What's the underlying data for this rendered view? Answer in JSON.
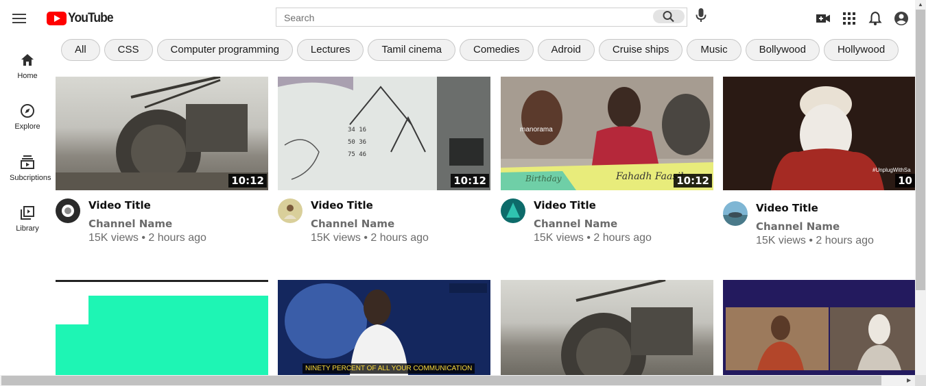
{
  "header": {
    "logo_text": "YouTube",
    "search_placeholder": "Search",
    "icons": [
      "menu-icon",
      "search-icon",
      "mic-icon",
      "create-video-icon",
      "apps-icon",
      "notifications-icon",
      "account-icon"
    ]
  },
  "sidebar": {
    "items": [
      {
        "label": "Home",
        "icon": "home-icon"
      },
      {
        "label": "Explore",
        "icon": "explore-icon"
      },
      {
        "label": "Subcriptions",
        "icon": "subscriptions-icon"
      },
      {
        "label": "Library",
        "icon": "library-icon"
      }
    ]
  },
  "chips": [
    "All",
    "CSS",
    "Computer programming",
    "Lectures",
    "Tamil cinema",
    "Comedies",
    "Adroid",
    "Cruise ships",
    "Music",
    "Bollywood",
    "Hollywood"
  ],
  "videos": [
    {
      "title": "Video Title",
      "channel": "Channel Name",
      "meta": "15K views • 2 hours ago",
      "duration": "10:12"
    },
    {
      "title": "Video Title",
      "channel": "Channel Name",
      "meta": "15K views • 2 hours ago",
      "duration": "10:12"
    },
    {
      "title": "Video Title",
      "channel": "Channel Name",
      "meta": "15K views • 2 hours ago",
      "duration": "10:12"
    },
    {
      "title": "Video Title",
      "channel": "Channel Name",
      "meta": "15K views • 2 hours ago",
      "duration": "10"
    }
  ],
  "thumb_text": {
    "brand": "manorama",
    "birthday": "Birthday",
    "signature": "Fahadh Faasil",
    "hashtag": "#UnplugWithSa",
    "subtitle": "NINETY PERCENT OF ALL YOUR COMMUNICATION"
  },
  "colors": {
    "brand_red": "#ff0000",
    "chip_bg": "#f1f1f1",
    "meta_gray": "#6b6b6b"
  }
}
